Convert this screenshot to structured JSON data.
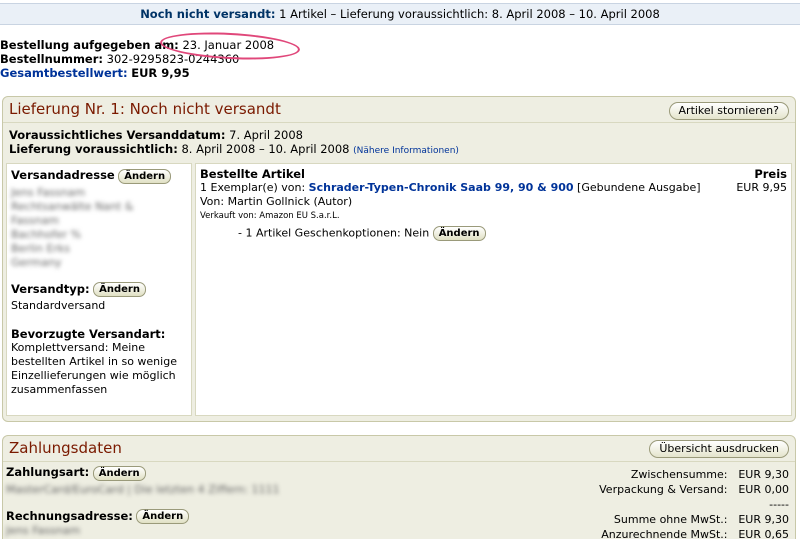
{
  "status_bar": {
    "status": "Noch nicht versandt:",
    "text": "1 Artikel – Lieferung voraussichtlich: 8. April 2008 – 10. April 2008"
  },
  "order": {
    "placed_label": "Bestellung aufgegeben am:",
    "placed_value": "23. Januar 2008",
    "number_label": "Bestellnummer:",
    "number_value": "302-9295823-0244360",
    "total_label": "Gesamtbestellwert:",
    "total_value": "EUR 9,95"
  },
  "shipment": {
    "title": "Lieferung Nr. 1: Noch nicht versandt",
    "cancel_button": "Artikel stornieren?",
    "ship_date_label": "Voraussichtliches Versanddatum:",
    "ship_date_value": "7. April 2008",
    "delivery_label": "Lieferung voraussichtlich:",
    "delivery_value": "8. April 2008 – 10. April 2008",
    "more_info": "(Nähere Informationen)",
    "address_label": "Versandadresse",
    "change_button": "Ändern",
    "address_lines": [
      "Jens Fassnam",
      "Rechtsanwälte Nant &",
      "Fassnam",
      "Bachhofer %",
      "Berlin Erks",
      "Germany"
    ],
    "shiptype_label": "Versandtyp:",
    "shiptype_value": "Standardversand",
    "pref_label": "Bevorzugte Versandart:",
    "pref_value": "Komplettversand: Meine bestellten Artikel in so wenige Einzellieferungen wie möglich zusammenfassen",
    "items_header": "Bestellte Artikel",
    "price_header": "Preis",
    "item_qty": "1 Exemplar(e) von:",
    "item_title": "Schrader-Typen-Chronik Saab 99, 90 & 900",
    "item_format": "[Gebundene Ausgabe]",
    "item_price": "EUR 9,95",
    "item_author": "Von: Martin Gollnick (Autor)",
    "item_seller": "Verkauft von: Amazon EU S.a.r.L.",
    "gift_options": "- 1 Artikel Geschenkoptionen: Nein"
  },
  "payment": {
    "title": "Zahlungsdaten",
    "print_button": "Übersicht ausdrucken",
    "method_label": "Zahlungsart:",
    "method_value": "MasterCard/EuroCard | Die letzten 4 Ziffern: 1111",
    "billing_label": "Rechnungsadresse:",
    "billing_value": "Jens Fassnam",
    "subtotal_label": "Zwischensumme:",
    "subtotal_value": "EUR 9,30",
    "shipping_label": "Verpackung & Versand:",
    "shipping_value": "EUR 0,00",
    "divider": "-----",
    "net_label": "Summe ohne MwSt.:",
    "net_value": "EUR 9,30",
    "vat_label": "Anzurechnende MwSt.:",
    "vat_value": "EUR 0,65"
  }
}
